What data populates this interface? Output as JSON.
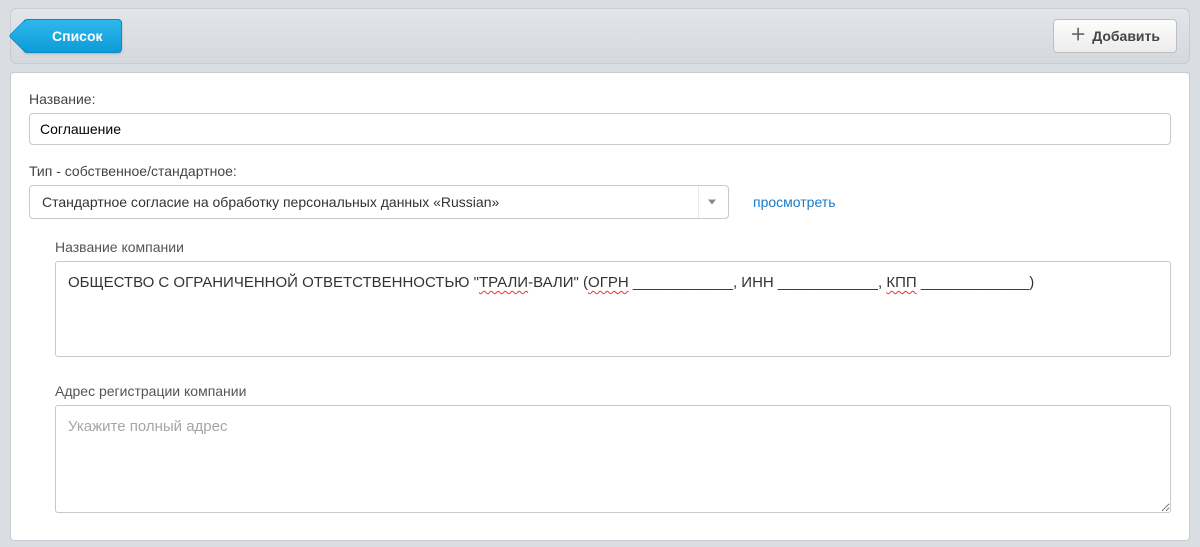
{
  "toolbar": {
    "list_label": "Список",
    "add_label": "Добавить"
  },
  "form": {
    "name_label": "Название:",
    "name_value": "Соглашение",
    "type_label": "Тип - собственное/стандартное:",
    "type_selected": "Стандартное согласие на обработку персональных данных «Russian»",
    "view_link": "просмотреть",
    "company_name_label": "Название компании",
    "company_name_value": "ОБЩЕСТВО С ОГРАНИЧЕННОЙ ОТВЕТСТВЕННОСТЬЮ \"ТРАЛИ-ВАЛИ\" (ОГРН ____________, ИНН ____________, КПП _____________)",
    "company_name_sp_pre": "ОБЩЕСТВО С ОГРАНИЧЕННОЙ ОТВЕТСТВЕННОСТЬЮ \"",
    "company_name_sp_1": "ТРАЛИ",
    "company_name_sp_mid1": "-ВАЛИ\" (",
    "company_name_sp_2": "ОГРН",
    "company_name_sp_mid2": " ____________, ИНН ____________, ",
    "company_name_sp_3": "КПП",
    "company_name_sp_post": " _____________)",
    "address_label": "Адрес регистрации компании",
    "address_placeholder": "Укажите полный адрес",
    "address_value": ""
  }
}
